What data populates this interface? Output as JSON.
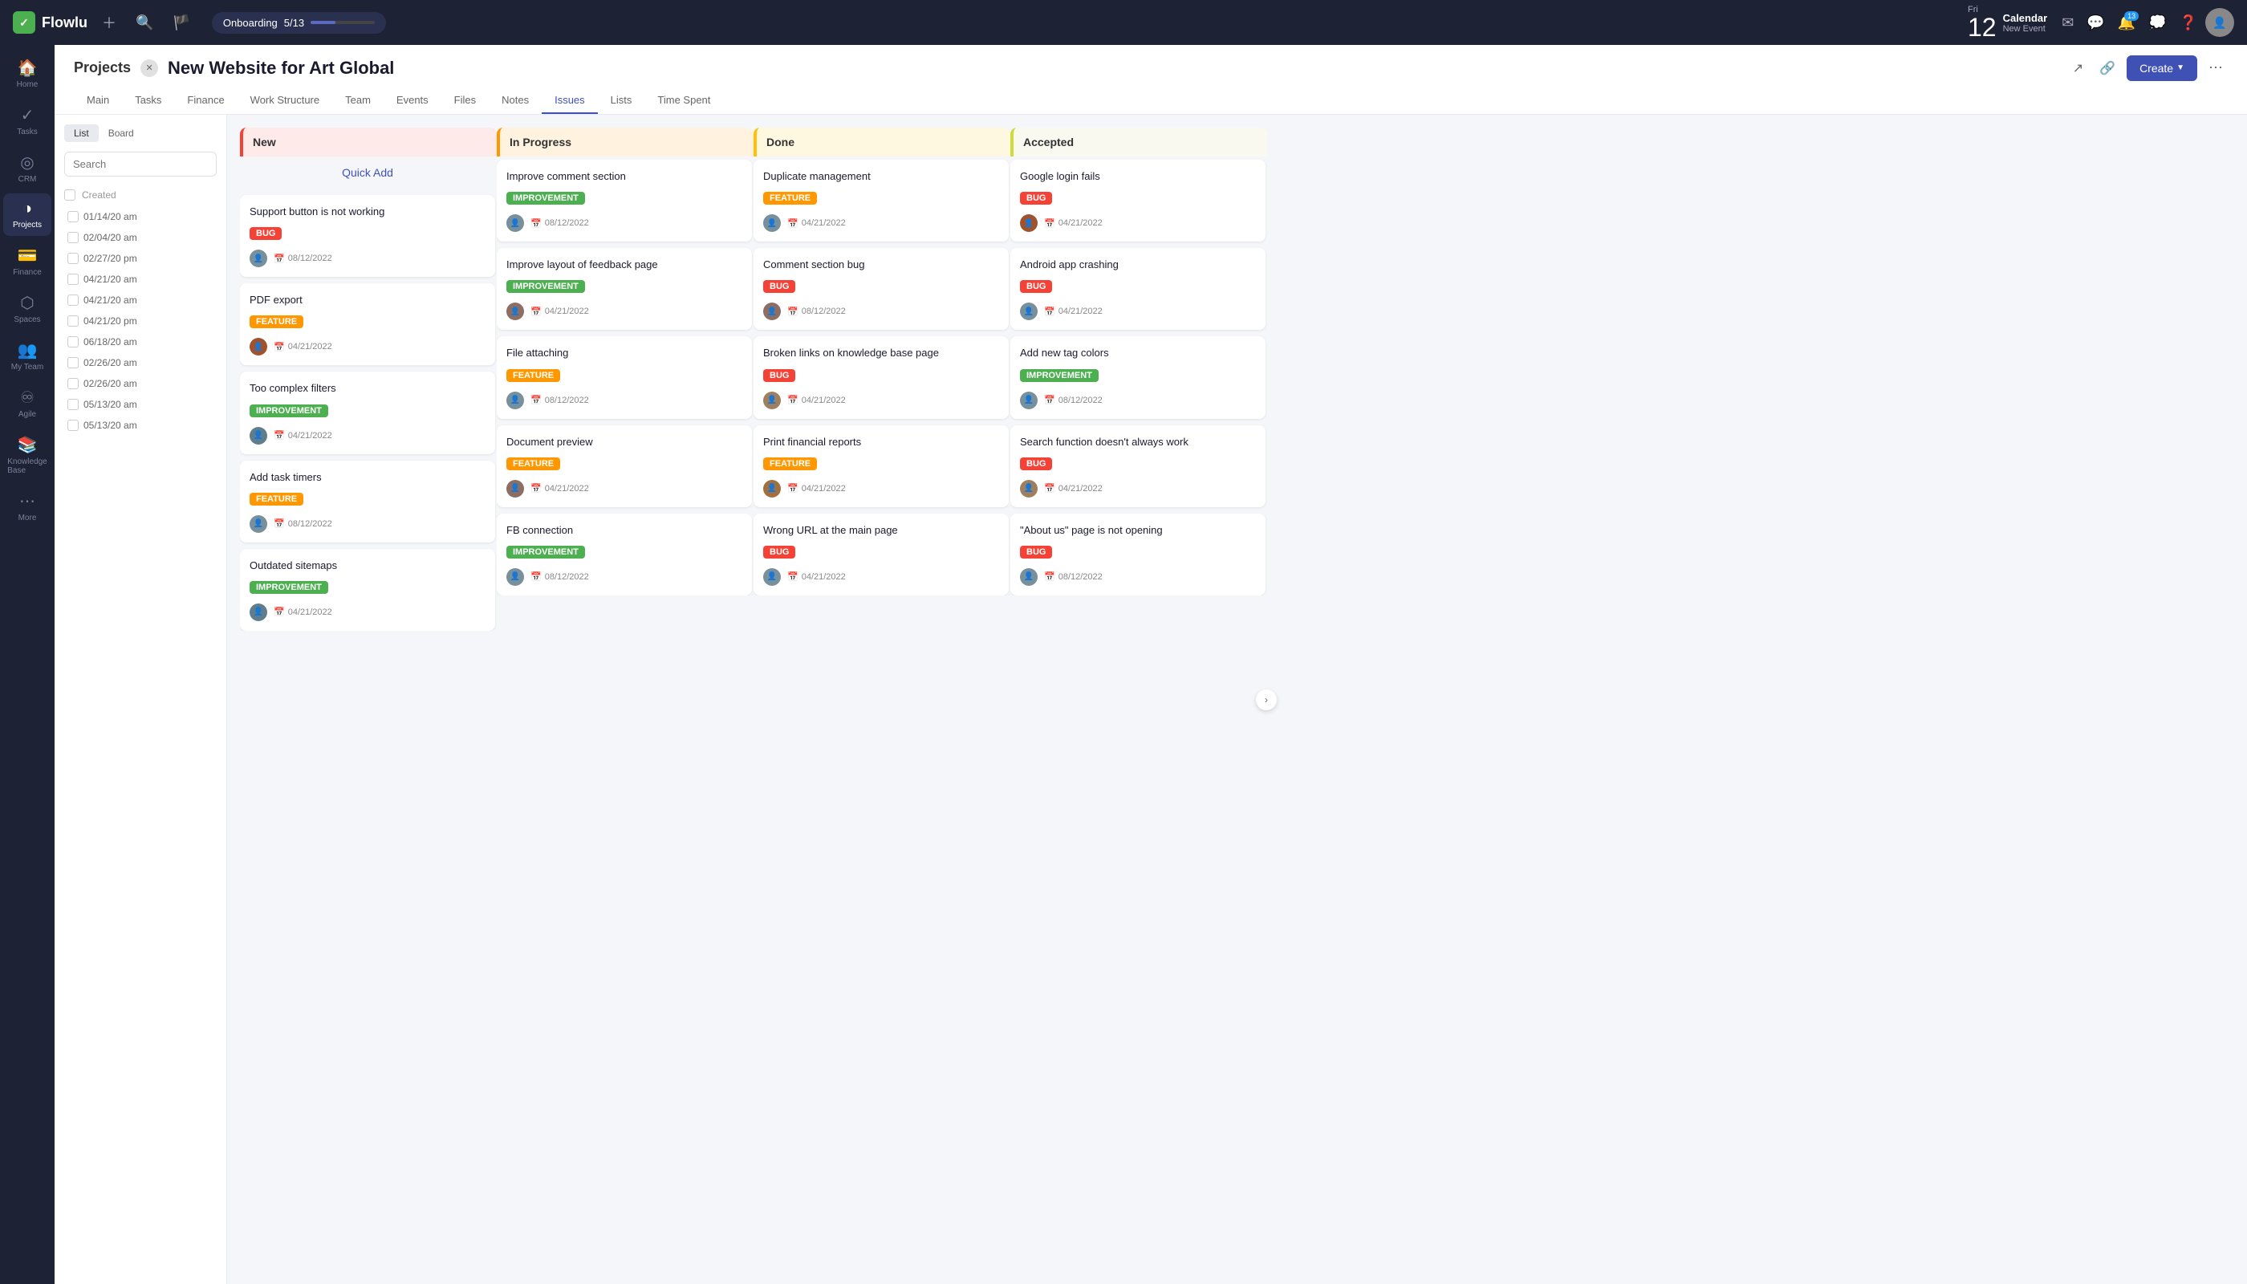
{
  "app": {
    "name": "Flowlu"
  },
  "topnav": {
    "onboarding_label": "Onboarding",
    "onboarding_progress": "5/13",
    "onboarding_fill_pct": 38,
    "calendar_day": "Fri",
    "calendar_date": "12",
    "calendar_title": "Calendar",
    "calendar_sub": "New Event",
    "notif_count": "13",
    "plus_label": "+",
    "search_label": "🔍"
  },
  "sidebar": {
    "items": [
      {
        "id": "home",
        "icon": "🏠",
        "label": "Home"
      },
      {
        "id": "tasks",
        "icon": "✓",
        "label": "Tasks"
      },
      {
        "id": "crm",
        "icon": "◎",
        "label": "CRM"
      },
      {
        "id": "projects",
        "icon": "◑",
        "label": "Projects",
        "active": true
      },
      {
        "id": "finance",
        "icon": "💳",
        "label": "Finance"
      },
      {
        "id": "spaces",
        "icon": "⬡",
        "label": "Spaces"
      },
      {
        "id": "myteam",
        "icon": "👥",
        "label": "My Team"
      },
      {
        "id": "agile",
        "icon": "♾",
        "label": "Agile"
      },
      {
        "id": "knowledge",
        "icon": "📚",
        "label": "Knowledge Base"
      },
      {
        "id": "more",
        "icon": "⋯",
        "label": "More"
      }
    ]
  },
  "project": {
    "breadcrumb": "Projects",
    "title": "New Website for Art Global",
    "tabs": [
      {
        "id": "main",
        "label": "Main"
      },
      {
        "id": "tasks",
        "label": "Tasks"
      },
      {
        "id": "finance",
        "label": "Finance"
      },
      {
        "id": "workstructure",
        "label": "Work Structure"
      },
      {
        "id": "team",
        "label": "Team"
      },
      {
        "id": "events",
        "label": "Events"
      },
      {
        "id": "files",
        "label": "Files"
      },
      {
        "id": "notes",
        "label": "Notes"
      },
      {
        "id": "issues",
        "label": "Issues",
        "active": true
      },
      {
        "id": "lists",
        "label": "Lists"
      },
      {
        "id": "timespent",
        "label": "Time Spent"
      }
    ],
    "view_tabs": [
      {
        "id": "list",
        "label": "List",
        "active": true
      },
      {
        "id": "board",
        "label": "Board"
      }
    ],
    "create_label": "Create",
    "search_placeholder": "Search"
  },
  "left_panel": {
    "search_placeholder": "Search",
    "header": "Created",
    "rows": [
      {
        "date": "01/14/20 am"
      },
      {
        "date": "02/04/20 am"
      },
      {
        "date": "02/27/20 pm"
      },
      {
        "date": "04/21/20 am"
      },
      {
        "date": "04/21/20 am"
      },
      {
        "date": "04/21/20 pm"
      },
      {
        "date": "06/18/20 am"
      },
      {
        "date": "02/26/20 am"
      },
      {
        "date": "02/26/20 am"
      },
      {
        "date": "05/13/20 am"
      },
      {
        "date": "05/13/20 am"
      }
    ]
  },
  "kanban": {
    "columns": [
      {
        "id": "new",
        "title": "New",
        "header_class": "col-header-new",
        "quick_add": "Quick Add",
        "cards": [
          {
            "title": "Support button is not working",
            "tag": "BUG",
            "tag_class": "tag-bug",
            "date": "08/12/2022",
            "avatar_bg": "#78909c"
          },
          {
            "title": "PDF export",
            "tag": "FEATURE",
            "tag_class": "tag-feature",
            "date": "04/21/2022",
            "avatar_bg": "#a0522d"
          },
          {
            "title": "Too complex filters",
            "tag": "IMPROVEMENT",
            "tag_class": "tag-improvement",
            "date": "04/21/2022",
            "avatar_bg": "#607d8b"
          },
          {
            "title": "Add task timers",
            "tag": "FEATURE",
            "tag_class": "tag-feature",
            "date": "08/12/2022",
            "avatar_bg": "#78909c"
          },
          {
            "title": "Outdated sitemaps",
            "tag": "IMPROVEMENT",
            "tag_class": "tag-improvement",
            "date": "04/21/2022",
            "avatar_bg": "#607d8b"
          }
        ]
      },
      {
        "id": "inprogress",
        "title": "In Progress",
        "header_class": "col-header-inprogress",
        "cards": [
          {
            "title": "Improve comment section",
            "tag": "IMPROVEMENT",
            "tag_class": "tag-improvement",
            "date": "08/12/2022",
            "avatar_bg": "#78909c"
          },
          {
            "title": "Improve layout of feedback page",
            "tag": "IMPROVEMENT",
            "tag_class": "tag-improvement",
            "date": "04/21/2022",
            "avatar_bg": "#8d6e63"
          },
          {
            "title": "File attaching",
            "tag": "FEATURE",
            "tag_class": "tag-feature",
            "date": "08/12/2022",
            "avatar_bg": "#78909c"
          },
          {
            "title": "Document preview",
            "tag": "FEATURE",
            "tag_class": "tag-feature",
            "date": "04/21/2022",
            "avatar_bg": "#8d6e63"
          },
          {
            "title": "FB connection",
            "tag": "IMPROVEMENT",
            "tag_class": "tag-improvement",
            "date": "08/12/2022",
            "avatar_bg": "#78909c"
          }
        ]
      },
      {
        "id": "done",
        "title": "Done",
        "header_class": "col-header-done",
        "cards": [
          {
            "title": "Duplicate management",
            "tag": "FEATURE",
            "tag_class": "tag-feature",
            "date": "04/21/2022",
            "avatar_bg": "#78909c"
          },
          {
            "title": "Comment section bug",
            "tag": "BUG",
            "tag_class": "tag-bug",
            "date": "08/12/2022",
            "avatar_bg": "#8d6e63"
          },
          {
            "title": "Broken links on knowledge base page",
            "tag": "BUG",
            "tag_class": "tag-bug",
            "date": "04/21/2022",
            "avatar_bg": "#9e8060"
          },
          {
            "title": "Print financial reports",
            "tag": "FEATURE",
            "tag_class": "tag-feature",
            "date": "04/21/2022",
            "avatar_bg": "#a07040"
          },
          {
            "title": "Wrong URL at the main page",
            "tag": "BUG",
            "tag_class": "tag-bug",
            "date": "04/21/2022",
            "avatar_bg": "#78909c"
          }
        ]
      },
      {
        "id": "accepted",
        "title": "Accepted",
        "header_class": "col-header-accepted",
        "cards": [
          {
            "title": "Google login fails",
            "tag": "BUG",
            "tag_class": "tag-bug",
            "date": "04/21/2022",
            "avatar_bg": "#a0522d"
          },
          {
            "title": "Android app crashing",
            "tag": "BUG",
            "tag_class": "tag-bug",
            "date": "04/21/2022",
            "avatar_bg": "#78909c"
          },
          {
            "title": "Add new tag colors",
            "tag": "IMPROVEMENT",
            "tag_class": "tag-improvement",
            "date": "08/12/2022",
            "avatar_bg": "#78909c"
          },
          {
            "title": "Search function doesn't always work",
            "tag": "BUG",
            "tag_class": "tag-bug",
            "date": "04/21/2022",
            "avatar_bg": "#9e8060"
          },
          {
            "title": "\"About us\" page is not opening",
            "tag": "BUG",
            "tag_class": "tag-bug",
            "date": "08/12/2022",
            "avatar_bg": "#78909c"
          }
        ]
      }
    ]
  }
}
